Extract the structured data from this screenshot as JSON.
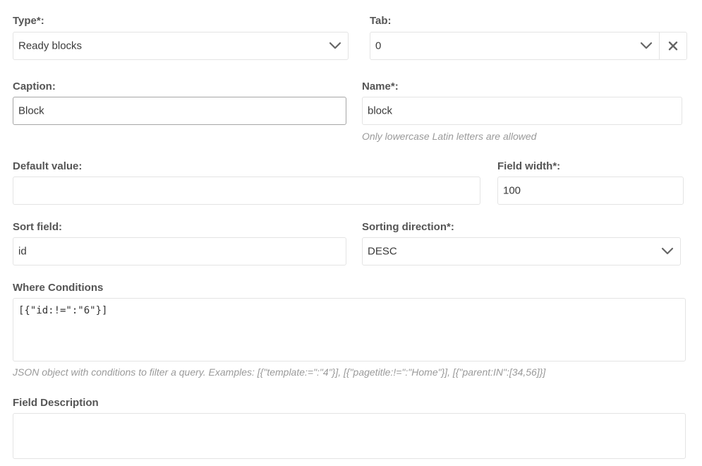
{
  "type": {
    "label": "Type*:",
    "value": "Ready blocks"
  },
  "tab": {
    "label": "Tab:",
    "value": "0"
  },
  "caption": {
    "label": "Caption:",
    "value": "Block"
  },
  "name": {
    "label": "Name*:",
    "value": "block",
    "hint": "Only lowercase Latin letters are allowed"
  },
  "default_value": {
    "label": "Default value:",
    "value": ""
  },
  "field_width": {
    "label": "Field width*:",
    "value": "100"
  },
  "sort_field": {
    "label": "Sort field:",
    "value": "id"
  },
  "sorting_direction": {
    "label": "Sorting direction*:",
    "value": "DESC"
  },
  "where_conditions": {
    "label": "Where Conditions",
    "value": "[{\"id:!=\":\"6\"}]",
    "hint": "JSON object with conditions to filter a query. Examples: [{\"template:=\":\"4\"}], [{\"pagetitle:!=\":\"Home\"}], [{\"parent:IN\":[34,56]}]"
  },
  "field_description": {
    "label": "Field Description",
    "value": ""
  },
  "icons": {
    "dropdown": "chevron-down-icon",
    "clear": "close-icon"
  }
}
